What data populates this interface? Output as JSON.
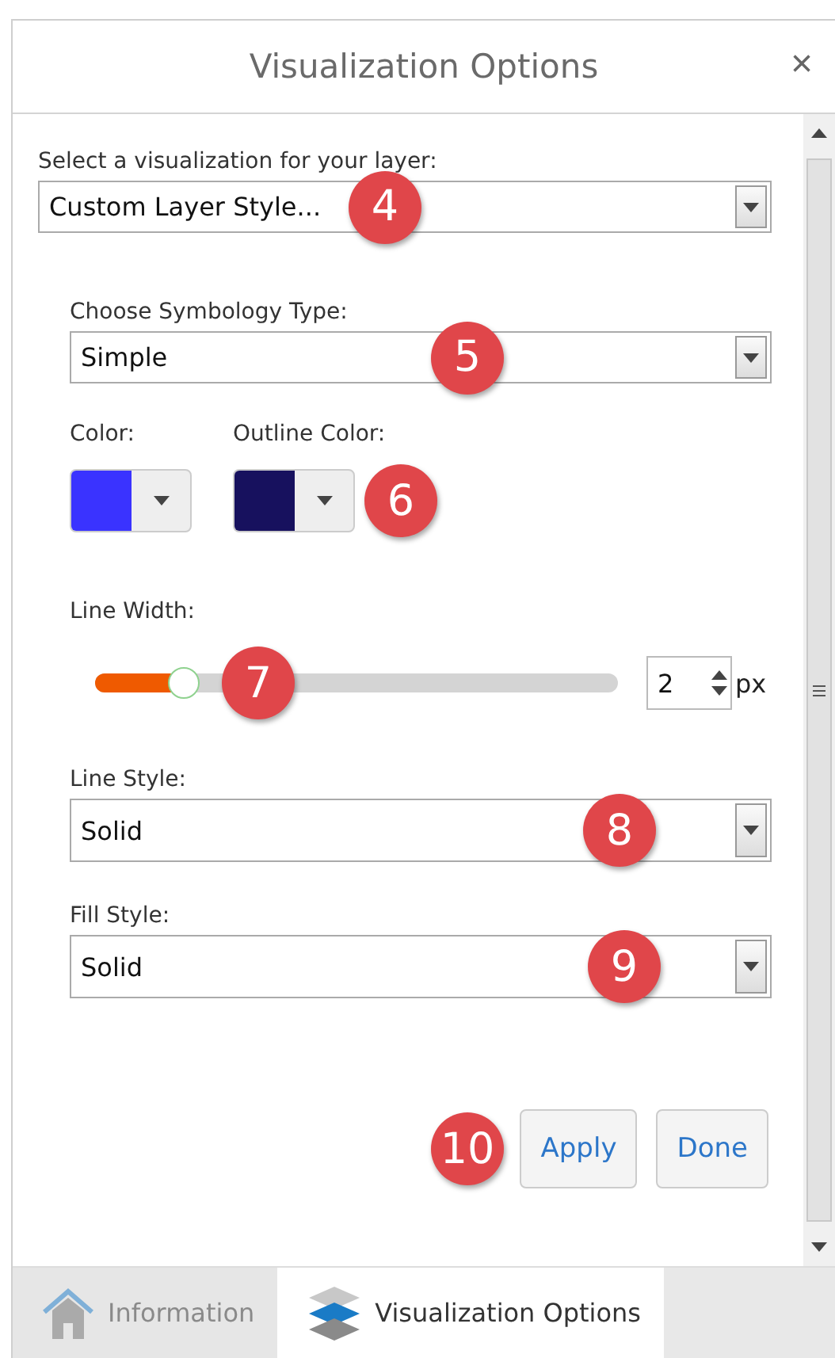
{
  "window": {
    "title": "Visualization Options",
    "close": "×"
  },
  "visualization": {
    "label": "Select a visualization for your layer:",
    "value": "Custom Layer Style...",
    "callout": "4"
  },
  "symbology": {
    "label": "Choose Symbology Type:",
    "value": "Simple",
    "callout": "5"
  },
  "colors": [
    {
      "label": "Color:",
      "color": "#3a33ff"
    },
    {
      "label": "Outline Color:",
      "color": "#17115e"
    }
  ],
  "colors_callout": "6",
  "line_width": {
    "label": "Line Width:",
    "level": 0.17,
    "value": "2",
    "unit": "px",
    "callout": "7"
  },
  "line_style": {
    "label": "Line Style:",
    "value": "Solid",
    "callout": "8"
  },
  "fill_style": {
    "label": "Fill Style:",
    "value": "Solid",
    "callout": "9"
  },
  "buttons_callout": "10",
  "buttons": [
    "Apply",
    "Done"
  ],
  "tabs": [
    {
      "label": "Information",
      "kind": "home",
      "selected": false
    },
    {
      "label": "Visualization Options",
      "kind": "layers",
      "selected": true
    }
  ]
}
